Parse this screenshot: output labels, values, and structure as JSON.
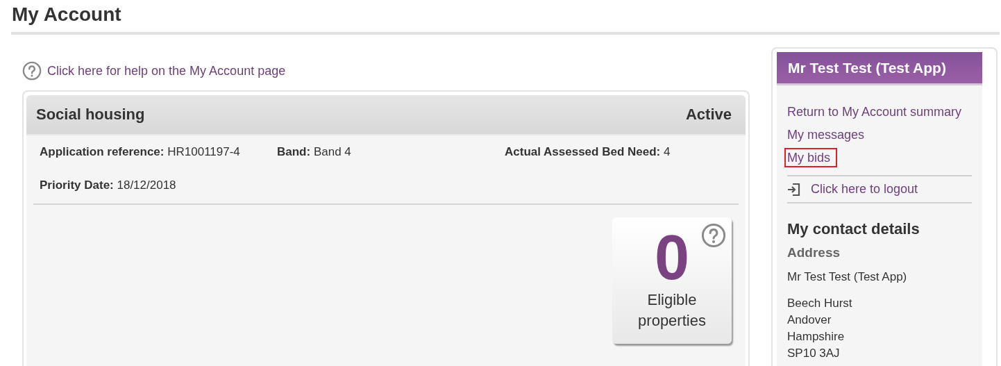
{
  "page_title": "My Account",
  "help_link": "Click here for help on the My Account page",
  "application": {
    "title": "Social housing",
    "status": "Active",
    "field_rows": [
      [
        {
          "label": "Application reference:",
          "value": "HR1001197-4"
        },
        {
          "label": "Band:",
          "value": "Band 4"
        },
        {
          "label": "Actual Assessed Bed Need:",
          "value": "4"
        }
      ],
      [
        {
          "label": "Priority Date:",
          "value": "18/12/2018"
        }
      ]
    ],
    "tile": {
      "count": "0",
      "caption": "Eligible properties"
    }
  },
  "sidebar": {
    "title": "Mr Test Test (Test App)",
    "links": [
      {
        "label": "Return to My Account summary",
        "highlighted": false
      },
      {
        "label": "My messages",
        "highlighted": false
      },
      {
        "label": "My bids",
        "highlighted": true
      }
    ],
    "logout": "Click here to logout",
    "contact_heading": "My contact details",
    "address_heading": "Address",
    "address_name": "Mr Test Test (Test App)",
    "address_lines": [
      "Beech Hurst",
      "Andover",
      "Hampshire",
      "SP10 3AJ"
    ]
  }
}
